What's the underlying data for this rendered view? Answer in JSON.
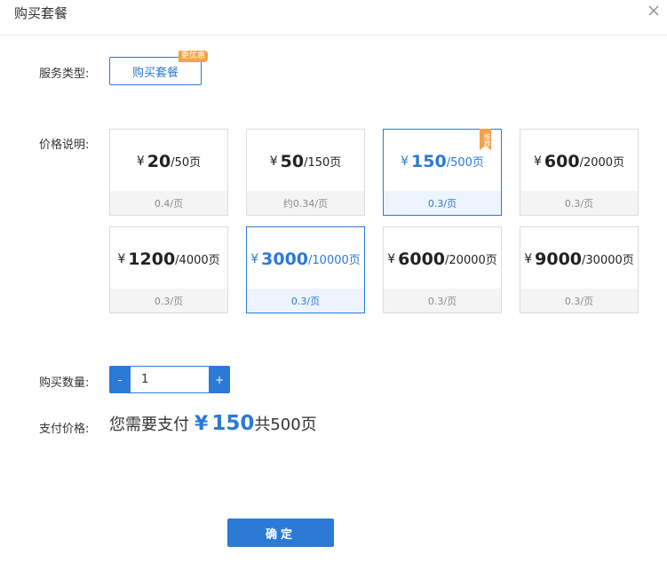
{
  "dialog": {
    "title": "购买套餐",
    "close_icon": "close-icon"
  },
  "service_type": {
    "label": "服务类型:",
    "button_label": "购买套餐",
    "badge": "更优惠"
  },
  "pricing": {
    "label": "价格说明:",
    "currency": "¥",
    "recommend_badge": "推荐",
    "cards": [
      {
        "amount": "20",
        "pages": "/50页",
        "unit_price": "0.4/页"
      },
      {
        "amount": "50",
        "pages": "/150页",
        "unit_price": "约0.34/页"
      },
      {
        "amount": "150",
        "pages": "/500页",
        "unit_price": "0.3/页"
      },
      {
        "amount": "600",
        "pages": "/2000页",
        "unit_price": "0.3/页"
      },
      {
        "amount": "1200",
        "pages": "/4000页",
        "unit_price": "0.3/页"
      },
      {
        "amount": "3000",
        "pages": "/10000页",
        "unit_price": "0.3/页"
      },
      {
        "amount": "6000",
        "pages": "/20000页",
        "unit_price": "0.3/页"
      },
      {
        "amount": "9000",
        "pages": "/30000页",
        "unit_price": "0.3/页"
      }
    ]
  },
  "quantity": {
    "label": "购买数量:",
    "minus": "-",
    "plus": "+",
    "value": "1"
  },
  "payment": {
    "label": "支付价格:",
    "prefix": "您需要支付",
    "currency": "¥",
    "amount": "150",
    "total_text": "共500页"
  },
  "actions": {
    "confirm_label": "确定"
  },
  "colors": {
    "accent": "#2b7ad6",
    "badge": "#f5a14a"
  }
}
